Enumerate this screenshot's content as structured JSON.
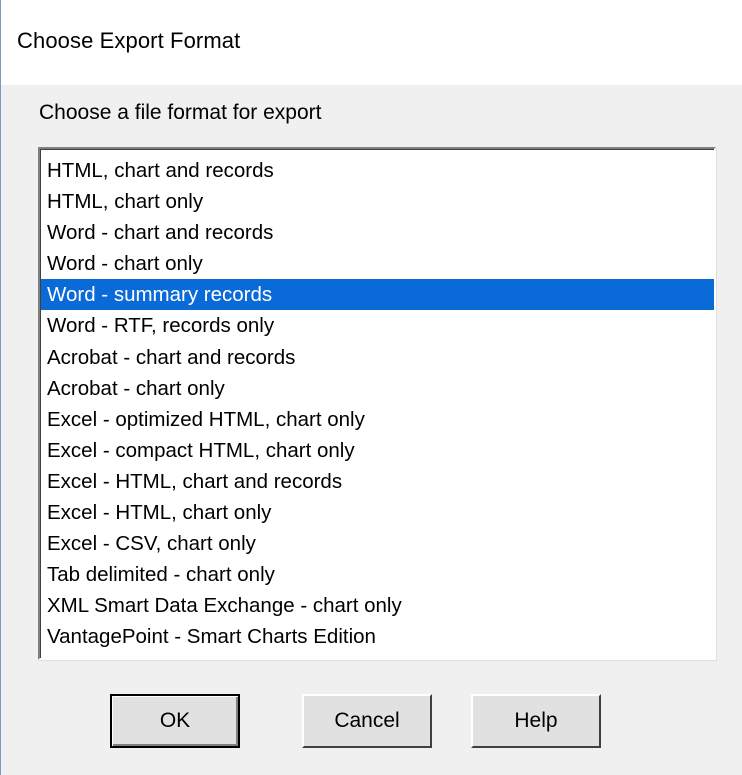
{
  "dialog": {
    "title": "Choose Export Format",
    "prompt": "Choose a file format for export",
    "formats": [
      "HTML, chart and records",
      "HTML, chart only",
      "Word - chart and records",
      "Word - chart only",
      "Word - summary records",
      "Word - RTF, records only",
      "Acrobat - chart and records",
      "Acrobat - chart only",
      "Excel - optimized HTML, chart only",
      "Excel - compact HTML, chart only",
      "Excel - HTML, chart and records",
      "Excel - HTML, chart only",
      "Excel - CSV, chart only",
      "Tab delimited - chart only",
      "XML Smart Data Exchange - chart only",
      "VantagePoint - Smart Charts Edition"
    ],
    "selected_format": "Word - summary records",
    "buttons": {
      "ok": "OK",
      "cancel": "Cancel",
      "help": "Help"
    }
  },
  "colors": {
    "selection": "#0a6ad8",
    "dialog_bg": "#f0f0f0"
  }
}
